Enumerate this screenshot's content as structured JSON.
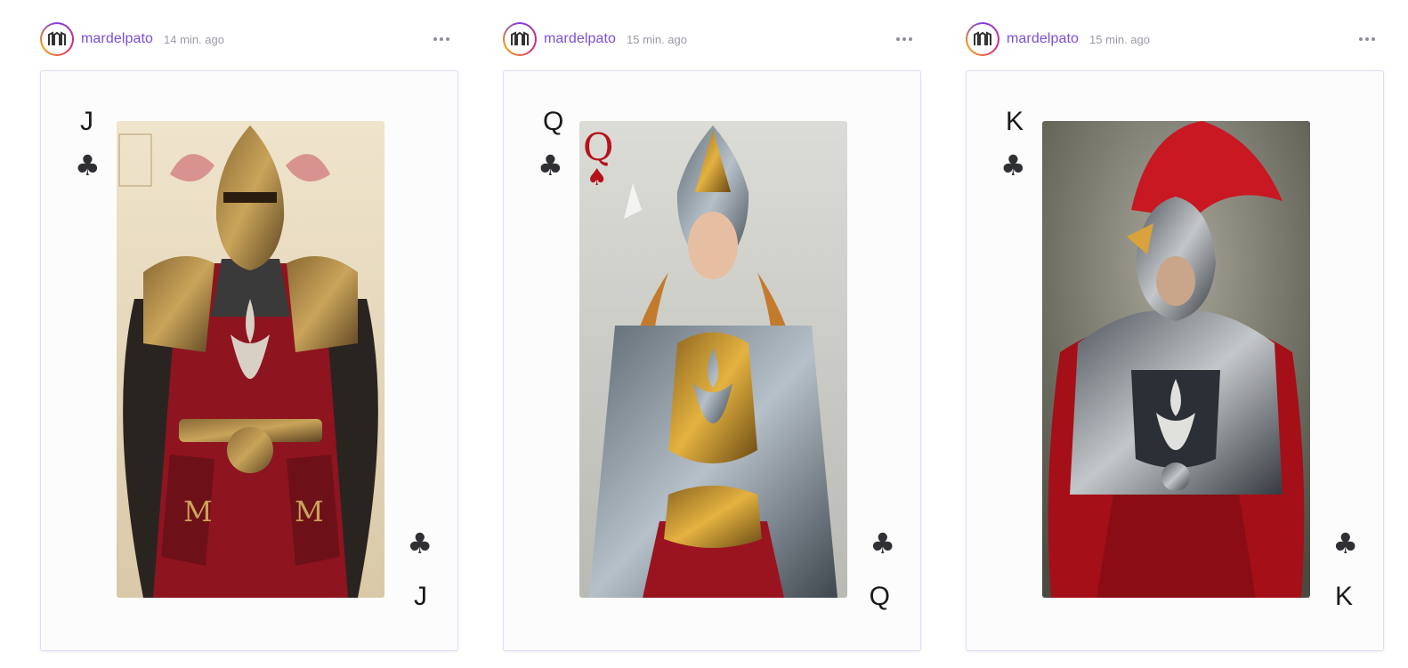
{
  "posts": [
    {
      "username": "mardelpato",
      "timestamp": "14 min. ago",
      "rank": "J",
      "suit_icon": "club-icon",
      "suit_glyph": "♣"
    },
    {
      "username": "mardelpato",
      "timestamp": "15 min. ago",
      "rank": "Q",
      "suit_icon": "club-icon",
      "suit_glyph": "♣",
      "art_corner_index": "Q",
      "art_corner_suit": "♠"
    },
    {
      "username": "mardelpato",
      "timestamp": "15 min. ago",
      "rank": "K",
      "suit_icon": "club-icon",
      "suit_glyph": "♣"
    }
  ],
  "colors": {
    "username": "#7c4ddb",
    "timestamp": "#9a9aa8",
    "card_border": "#e0ddf3",
    "armor_red": "#a3121c",
    "armor_gold": "#c9a24a"
  }
}
